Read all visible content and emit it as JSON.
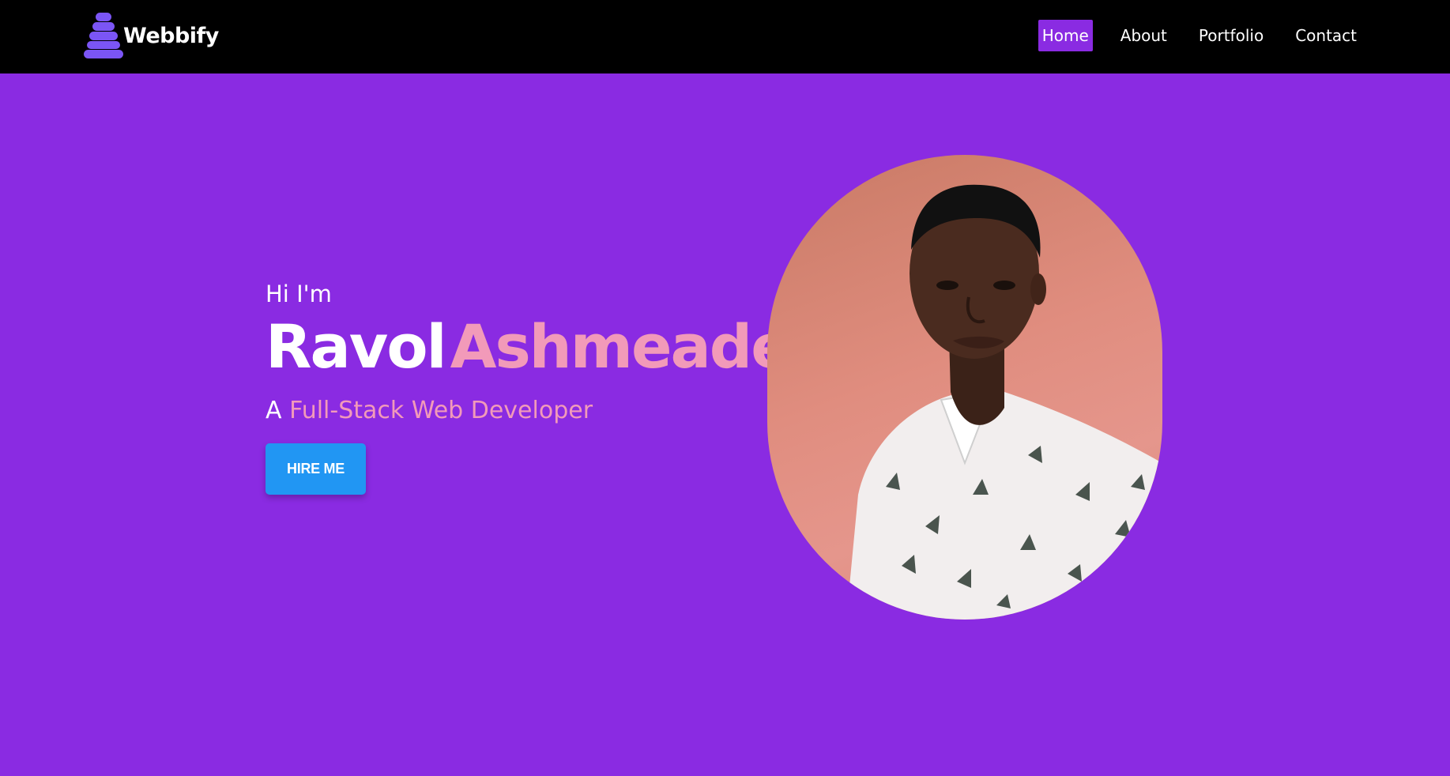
{
  "brand": {
    "name": "Webbify",
    "logo_icon": "stacked-stones-icon",
    "logo_color": "#7b55f5"
  },
  "nav": {
    "items": [
      {
        "label": "Home",
        "active": true
      },
      {
        "label": "About",
        "active": false
      },
      {
        "label": "Portfolio",
        "active": false
      },
      {
        "label": "Contact",
        "active": false
      }
    ]
  },
  "hero": {
    "greeting": "Hi I'm",
    "first_name": "Ravol",
    "last_name": "Ashmeade",
    "role_prefix": "A",
    "role_title": "Full-Stack Web Developer",
    "cta_label": "HIRE ME"
  },
  "colors": {
    "background": "#8a2be2",
    "navbar": "#000000",
    "accent_pink": "#f29ab9",
    "button_blue": "#2196f3"
  }
}
